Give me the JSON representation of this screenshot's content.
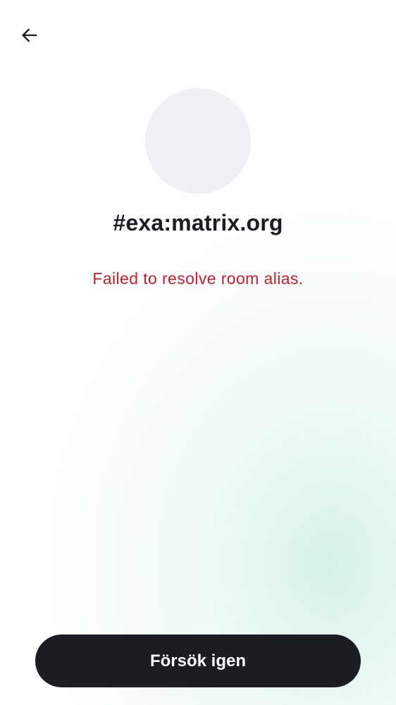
{
  "header": {
    "back_icon": "arrow-left-icon"
  },
  "room": {
    "alias": "#exa:matrix.org",
    "error_message": "Failed to resolve room alias."
  },
  "actions": {
    "retry_label": "Försök igen"
  },
  "colors": {
    "error": "#d51928",
    "primary_button": "#1b1d22",
    "avatar_placeholder": "#f0f1f5",
    "gradient_accent": "#c8eee0"
  }
}
